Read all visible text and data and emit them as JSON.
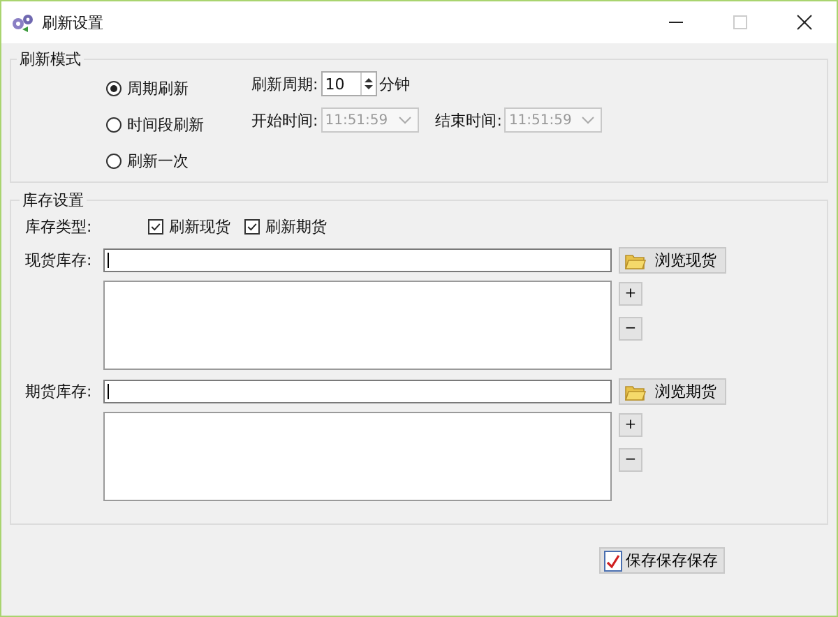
{
  "window": {
    "title": "刷新设置"
  },
  "refresh_mode": {
    "title": "刷新模式",
    "options": [
      {
        "label": "周期刷新",
        "selected": true
      },
      {
        "label": "时间段刷新",
        "selected": false
      },
      {
        "label": "刷新一次",
        "selected": false
      }
    ],
    "period": {
      "label": "刷新周期:",
      "value": "10",
      "unit": "分钟"
    },
    "start_time": {
      "label": "开始时间:",
      "value": "11:51:59",
      "disabled": true
    },
    "end_time": {
      "label": "结束时间:",
      "value": "11:51:59",
      "disabled": true
    }
  },
  "inventory": {
    "title": "库存设置",
    "type_label": "库存类型:",
    "types": [
      {
        "label": "刷新现货",
        "checked": true
      },
      {
        "label": "刷新期货",
        "checked": true
      }
    ],
    "sections": [
      {
        "label": "现货库存:",
        "browse": "浏览现货",
        "add": "+",
        "remove": "−"
      },
      {
        "label": "期货库存:",
        "browse": "浏览期货",
        "add": "+",
        "remove": "−"
      }
    ]
  },
  "save_button": "保存保存保存"
}
